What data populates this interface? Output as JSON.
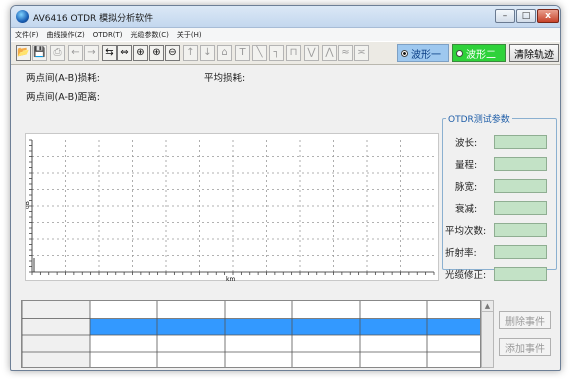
{
  "window": {
    "title": "AV6416 OTDR 模拟分析软件",
    "controls": {
      "minimize": "–",
      "maximize": "□",
      "close": "x"
    }
  },
  "menu": [
    "文件(F)",
    "曲线操作(Z)",
    "OTDR(T)",
    "光缆参数(C)",
    "关于(H)"
  ],
  "toolbar": {
    "tools": [
      {
        "name": "open-icon",
        "glyph": "📂",
        "enabled": true
      },
      {
        "name": "save-icon",
        "glyph": "💾",
        "enabled": false
      },
      {
        "name": "print-icon",
        "glyph": "⎙",
        "enabled": false
      },
      {
        "name": "arrow-left-icon",
        "glyph": "←",
        "enabled": false
      },
      {
        "name": "arrow-right-icon",
        "glyph": "→",
        "enabled": false
      },
      {
        "name": "zoom-h-in-icon",
        "glyph": "⇆",
        "enabled": true
      },
      {
        "name": "zoom-h-out-icon",
        "glyph": "⇔",
        "enabled": true
      },
      {
        "name": "zoom-region-icon",
        "glyph": "⊕",
        "enabled": true
      },
      {
        "name": "zoom-in-icon",
        "glyph": "⊕",
        "enabled": true
      },
      {
        "name": "zoom-out-icon",
        "glyph": "⊖",
        "enabled": true
      },
      {
        "name": "arrow-up-icon",
        "glyph": "↑",
        "enabled": false
      },
      {
        "name": "arrow-down-icon",
        "glyph": "↓",
        "enabled": false
      },
      {
        "name": "marker-ab-icon",
        "glyph": "⌂",
        "enabled": false
      },
      {
        "name": "text-icon",
        "glyph": "T",
        "enabled": false
      },
      {
        "name": "slope-icon",
        "glyph": "╲",
        "enabled": false
      },
      {
        "name": "step-down-icon",
        "glyph": "┐",
        "enabled": false
      },
      {
        "name": "pulse-icon",
        "glyph": "⊓",
        "enabled": false
      },
      {
        "name": "peak-up-icon",
        "glyph": "⋁",
        "enabled": false
      },
      {
        "name": "peak-icon",
        "glyph": "⋀",
        "enabled": false
      },
      {
        "name": "reflect-icon",
        "glyph": "≈",
        "enabled": false
      },
      {
        "name": "splice-icon",
        "glyph": "≍",
        "enabled": false
      }
    ],
    "wave1": "波形一",
    "wave2": "波形二",
    "clear": "清除轨迹",
    "wave1_color": "#9ec8ef",
    "wave2_color": "#2fd23a"
  },
  "measure": {
    "ab_loss_label": "两点间(A-B)损耗:",
    "avg_loss_label": "平均损耗:",
    "ab_distance_label": "两点间(A-B)距离:"
  },
  "plot": {
    "ylabel": "dB",
    "xlabel": "km"
  },
  "params": {
    "title": "OTDR测试参数",
    "rows": [
      {
        "label": "波长:",
        "value": ""
      },
      {
        "label": "量程:",
        "value": ""
      },
      {
        "label": "脉宽:",
        "value": ""
      },
      {
        "label": "衰减:",
        "value": ""
      },
      {
        "label": "平均次数:",
        "value": ""
      },
      {
        "label": "折射率:",
        "value": ""
      },
      {
        "label": "光缆修正:",
        "value": ""
      }
    ],
    "box_color": "#c3e2c6"
  },
  "events": {
    "selected_row_color": "#3399ff",
    "delete_button": "删除事件",
    "add_button": "添加事件"
  }
}
